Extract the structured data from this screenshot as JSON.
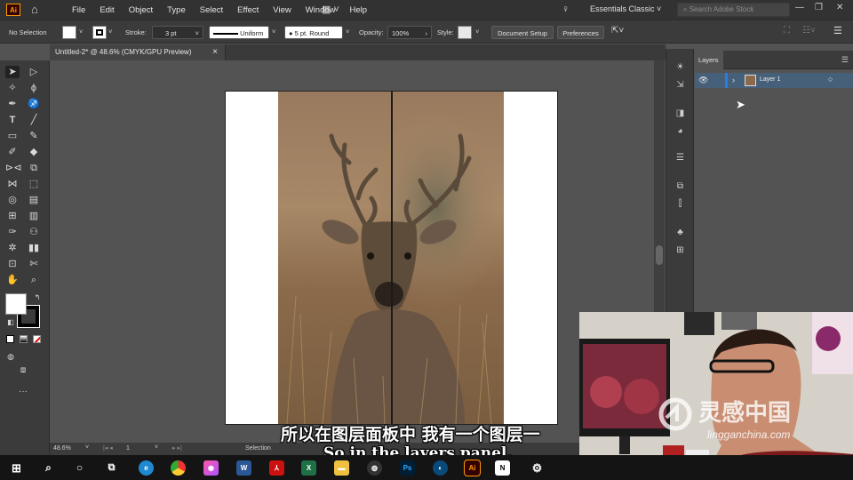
{
  "app": {
    "logo": "Ai",
    "menus": [
      "File",
      "Edit",
      "Object",
      "Type",
      "Select",
      "Effect",
      "View",
      "Window",
      "Help"
    ],
    "workspace": "Essentials Classic",
    "stock_placeholder": "Search Adobe Stock"
  },
  "control_bar": {
    "selection": "No Selection",
    "stroke_label": "Stroke:",
    "stroke_value": "3 pt",
    "profile": "Uniform",
    "brush": "5 pt. Round",
    "opacity_label": "Opacity:",
    "opacity_value": "100%",
    "style_label": "Style:",
    "document_setup": "Document Setup",
    "preferences": "Preferences"
  },
  "document": {
    "tab_title": "Untitled-2* @ 48.6% (CMYK/GPU Preview)",
    "close_icon": "×"
  },
  "status_bar": {
    "zoom": "48.6%",
    "artboard": "1",
    "tool": "Selection"
  },
  "layers_panel": {
    "tab": "Layers",
    "layers": [
      {
        "name": "Layer 1",
        "visible": true
      }
    ]
  },
  "subtitles": {
    "chinese": "所以在图层面板中 我有一个图层一",
    "english": "So in the layers panel,"
  },
  "watermark": {
    "brand": "灵感中国",
    "url": "lingganchina.com"
  },
  "taskbar": {
    "apps": [
      "windows-start",
      "search",
      "cortana",
      "task-view",
      "edge",
      "chrome",
      "photos",
      "word",
      "acrobat",
      "excel",
      "explorer",
      "obs",
      "photoshop",
      "media",
      "illustrator",
      "app",
      "notion",
      "settings"
    ]
  },
  "colors": {
    "menubar": "#323232",
    "panel": "#3b3b3b",
    "canvas": "#535353",
    "selection_row": "#46607a",
    "ai_orange": "#ff9a00"
  }
}
